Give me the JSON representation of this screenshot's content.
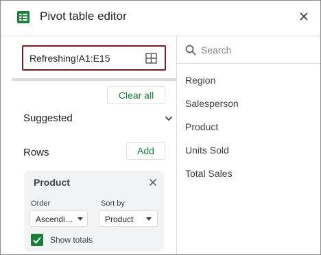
{
  "header": {
    "title": "Pivot table editor"
  },
  "range": {
    "value": "Refreshing!A1:E15"
  },
  "buttons": {
    "clear_all": "Clear all",
    "add": "Add"
  },
  "sections": {
    "suggested": "Suggested",
    "rows": "Rows"
  },
  "row_card": {
    "title": "Product",
    "order_label": "Order",
    "order_value": "Ascendi…",
    "sortby_label": "Sort by",
    "sortby_value": "Product",
    "show_totals_label": "Show totals",
    "show_totals_checked": true
  },
  "search": {
    "placeholder": "Search"
  },
  "fields": [
    "Region",
    "Salesperson",
    "Product",
    "Units Sold",
    "Total Sales"
  ],
  "colors": {
    "accent_green": "#188038",
    "range_border": "#7b1b22"
  }
}
